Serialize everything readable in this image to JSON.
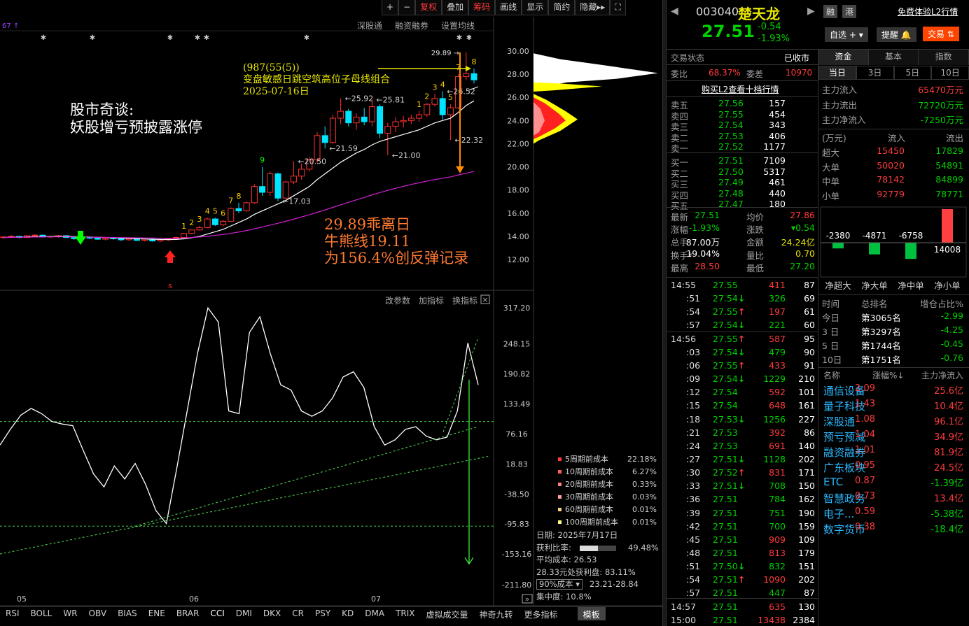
{
  "toolbar": {
    "items": [
      "+",
      "−",
      "复权",
      "叠加",
      "筹码",
      "画线",
      "显示",
      "简约",
      "隐藏▸▸",
      "⛶"
    ]
  },
  "subtoolbar": {
    "items": [
      "深股通",
      "融资融券",
      "设置均线"
    ]
  },
  "indicator_toolbar": {
    "items": [
      "改参数",
      "加指标",
      "换指标"
    ]
  },
  "annotations": {
    "title_line1": "股市奇谈:",
    "title_line2": "妖股增亏预披露涨停",
    "pattern_code": "(987(55(5))",
    "pattern_desc": "变盘敏感日跳空筑高位子母线组合",
    "pattern_date": "2025-07-16日",
    "div_line1": "29.89乖离日",
    "div_line2": "牛熊线19.11",
    "div_line3": "为156.4%创反弹记录",
    "peak_label": "29.89",
    "labels": [
      "25.92",
      "25.81",
      "26.52",
      "21.59",
      "21.00",
      "22.32",
      "20.50",
      "17.03"
    ]
  },
  "price_axis": [
    "30.00",
    "28.00",
    "26.00",
    "24.00",
    "22.00",
    "20.00",
    "18.00",
    "16.00",
    "14.00",
    "12.00"
  ],
  "cci_axis": [
    "317.20",
    "248.15",
    "190.82",
    "133.49",
    "76.16",
    "18.83",
    "-38.50",
    "-95.83",
    "-153.16",
    "-211.80"
  ],
  "x_months": [
    "05",
    "06",
    "07"
  ],
  "cost_distribution": {
    "legend": [
      {
        "label": "5周期前成本",
        "value": "22.18%",
        "color": "#ff3b3b"
      },
      {
        "label": "10周期前成本",
        "value": "6.27%",
        "color": "#ff6060"
      },
      {
        "label": "20周期前成本",
        "value": "0.33%",
        "color": "#ff8080"
      },
      {
        "label": "30周期前成本",
        "value": "0.03%",
        "color": "#ffa0a0"
      },
      {
        "label": "60周期前成本",
        "value": "0.01%",
        "color": "#ffd080"
      },
      {
        "label": "100周期前成本",
        "value": "0.01%",
        "color": "#ffff80"
      }
    ],
    "date_label": "日期: 2025年7月17日",
    "profit_ratio_label": "获利比率:",
    "profit_ratio": "49.48%",
    "profit_ratio_fill": 0.4948,
    "avg_cost": "平均成本: 26.53",
    "profit_at_price": "28.33元处获利盘: 83.11%",
    "cost_select": "90%成本",
    "cost_range": "23.21-28.84",
    "concentration": "集中度: 10.8%"
  },
  "bottom_tabs": [
    "RSI",
    "BOLL",
    "WR",
    "OBV",
    "BIAS",
    "ENE",
    "BRAR",
    "CCI",
    "DMI",
    "DKX",
    "CR",
    "PSY",
    "KD",
    "DMA",
    "TRIX",
    "虚拟成交量",
    "神奇九转",
    "更多指标",
    "模板"
  ],
  "stock": {
    "code": "003040",
    "name": "楚天龙",
    "price": "27.51",
    "change": "-0.54",
    "change_pct": "-1.93%",
    "tag_rong": "融",
    "tag_gang": "港",
    "l2_link": "免费体验L2行情",
    "btn_watch": "自选 +",
    "btn_alert": "提醒",
    "btn_trade": "交易"
  },
  "status": {
    "label": "交易状态",
    "value": "已收市",
    "weibi_label": "委比",
    "weibi": "68.37%",
    "weicha_label": "委差",
    "weicha": "10970",
    "l2_buy": "购买L2查看十档行情"
  },
  "orderbook": {
    "asks": [
      {
        "label": "卖五",
        "price": "27.56",
        "vol": "157"
      },
      {
        "label": "卖四",
        "price": "27.55",
        "vol": "454"
      },
      {
        "label": "卖三",
        "price": "27.54",
        "vol": "343"
      },
      {
        "label": "卖二",
        "price": "27.53",
        "vol": "406"
      },
      {
        "label": "卖一",
        "price": "27.52",
        "vol": "1177"
      }
    ],
    "bids": [
      {
        "label": "买一",
        "price": "27.51",
        "vol": "7109"
      },
      {
        "label": "买二",
        "price": "27.50",
        "vol": "5317"
      },
      {
        "label": "买三",
        "price": "27.49",
        "vol": "461"
      },
      {
        "label": "买四",
        "price": "27.48",
        "vol": "440"
      },
      {
        "label": "买五",
        "price": "27.47",
        "vol": "180"
      }
    ]
  },
  "stats": [
    {
      "l1": "最新",
      "v1": "27.51",
      "l2": "均价",
      "v2": "27.86",
      "c1": "green",
      "c2": "red"
    },
    {
      "l1": "涨幅",
      "v1": "-1.93%",
      "l2": "涨跌",
      "v2": "▾0.54",
      "c1": "green",
      "c2": "green"
    },
    {
      "l1": "总手",
      "v1": "87.00万",
      "l2": "金额",
      "v2": "24.24亿",
      "c1": "white",
      "c2": "yellow"
    },
    {
      "l1": "换手*",
      "v1": "19.04%",
      "l2": "量比",
      "v2": "0.70",
      "c1": "white",
      "c2": "yellow"
    },
    {
      "l1": "最高",
      "v1": "28.50",
      "l2": "最低",
      "v2": "27.20",
      "c1": "red",
      "c2": "green"
    }
  ],
  "ticks": [
    {
      "t": "14:55",
      "p": "27.55",
      "a": "",
      "v": "411",
      "n": "87",
      "pc": "green",
      "vc": "red"
    },
    {
      "t": ":51",
      "p": "27.54",
      "a": "↓",
      "v": "326",
      "n": "69",
      "pc": "green",
      "vc": "green"
    },
    {
      "t": ":54",
      "p": "27.55",
      "a": "↑",
      "v": "197",
      "n": "61",
      "pc": "green",
      "vc": "red"
    },
    {
      "t": ":57",
      "p": "27.54",
      "a": "↓",
      "v": "221",
      "n": "60",
      "pc": "green",
      "vc": "green"
    },
    {
      "t": "14:56",
      "p": "27.55",
      "a": "↑",
      "v": "587",
      "n": "95",
      "pc": "green",
      "vc": "red"
    },
    {
      "t": ":03",
      "p": "27.54",
      "a": "↓",
      "v": "479",
      "n": "90",
      "pc": "green",
      "vc": "green"
    },
    {
      "t": ":06",
      "p": "27.55",
      "a": "↑",
      "v": "433",
      "n": "91",
      "pc": "green",
      "vc": "red"
    },
    {
      "t": ":09",
      "p": "27.54",
      "a": "↓",
      "v": "1229",
      "n": "210",
      "pc": "green",
      "vc": "green"
    },
    {
      "t": ":12",
      "p": "27.54",
      "a": "",
      "v": "592",
      "n": "101",
      "pc": "green",
      "vc": "red"
    },
    {
      "t": ":15",
      "p": "27.54",
      "a": "",
      "v": "648",
      "n": "161",
      "pc": "green",
      "vc": "red"
    },
    {
      "t": ":18",
      "p": "27.53",
      "a": "↓",
      "v": "1256",
      "n": "227",
      "pc": "green",
      "vc": "green"
    },
    {
      "t": ":21",
      "p": "27.53",
      "a": "",
      "v": "392",
      "n": "86",
      "pc": "green",
      "vc": "red"
    },
    {
      "t": ":24",
      "p": "27.53",
      "a": "",
      "v": "691",
      "n": "140",
      "pc": "green",
      "vc": "red"
    },
    {
      "t": ":27",
      "p": "27.51",
      "a": "↓",
      "v": "1128",
      "n": "202",
      "pc": "green",
      "vc": "green"
    },
    {
      "t": ":30",
      "p": "27.52",
      "a": "↑",
      "v": "831",
      "n": "171",
      "pc": "green",
      "vc": "red"
    },
    {
      "t": ":33",
      "p": "27.51",
      "a": "↓",
      "v": "708",
      "n": "150",
      "pc": "green",
      "vc": "green"
    },
    {
      "t": ":36",
      "p": "27.51",
      "a": "",
      "v": "784",
      "n": "162",
      "pc": "green",
      "vc": "green"
    },
    {
      "t": ":39",
      "p": "27.51",
      "a": "",
      "v": "751",
      "n": "190",
      "pc": "green",
      "vc": "green"
    },
    {
      "t": ":42",
      "p": "27.51",
      "a": "",
      "v": "700",
      "n": "159",
      "pc": "green",
      "vc": "green"
    },
    {
      "t": ":45",
      "p": "27.51",
      "a": "",
      "v": "909",
      "n": "109",
      "pc": "green",
      "vc": "red"
    },
    {
      "t": ":48",
      "p": "27.51",
      "a": "",
      "v": "813",
      "n": "179",
      "pc": "green",
      "vc": "red"
    },
    {
      "t": ":51",
      "p": "27.50",
      "a": "↓",
      "v": "832",
      "n": "151",
      "pc": "green",
      "vc": "green"
    },
    {
      "t": ":54",
      "p": "27.51",
      "a": "↑",
      "v": "1090",
      "n": "202",
      "pc": "green",
      "vc": "red"
    },
    {
      "t": ":57",
      "p": "27.51",
      "a": "",
      "v": "447",
      "n": "87",
      "pc": "green",
      "vc": "green"
    },
    {
      "t": "14:57",
      "p": "27.51",
      "a": "",
      "v": "635",
      "n": "130",
      "pc": "green",
      "vc": "red"
    },
    {
      "t": "15:00",
      "p": "27.51",
      "a": "",
      "v": "13438",
      "n": "2384",
      "pc": "green",
      "vc": "red"
    }
  ],
  "fund_tabs": [
    "资金",
    "基本",
    "指数"
  ],
  "period_tabs": [
    "当日",
    "3日",
    "5日",
    "10日"
  ],
  "main_flow": [
    {
      "label": "主力流入",
      "value": "65470万元",
      "color": "red"
    },
    {
      "label": "主力流出",
      "value": "72720万元",
      "color": "green"
    },
    {
      "label": "主力净流入",
      "value": "-7250万元",
      "color": "green"
    }
  ],
  "flow_header": {
    "unit": "(万元)",
    "in": "流入",
    "out": "流出"
  },
  "flow_table": [
    {
      "label": "超大",
      "in": "15450",
      "out": "17829"
    },
    {
      "label": "大单",
      "in": "50020",
      "out": "54891"
    },
    {
      "label": "中单",
      "in": "78142",
      "out": "84899"
    },
    {
      "label": "小单",
      "in": "92779",
      "out": "78771"
    }
  ],
  "net_flow": {
    "values": [
      -2380,
      -4871,
      -6758,
      14008
    ],
    "labels": [
      "-2380",
      "-4871",
      "-6758",
      "14008"
    ],
    "categories": [
      "净超大",
      "净大单",
      "净中单",
      "净小单"
    ]
  },
  "rank": {
    "header": [
      "时间",
      "总排名",
      "增仓占比%"
    ],
    "rows": [
      {
        "time": "今日",
        "rank": "第3065名",
        "ratio": "-2.99"
      },
      {
        "time": "3 日",
        "rank": "第3297名",
        "ratio": "-4.25"
      },
      {
        "time": "5 日",
        "rank": "第1744名",
        "ratio": "-0.45"
      },
      {
        "time": "10日",
        "rank": "第1751名",
        "ratio": "-0.76"
      }
    ]
  },
  "sectors": {
    "header": [
      "名称",
      "涨幅%↓",
      "主力净流入"
    ],
    "rows": [
      {
        "name": "通信设备",
        "pct": "2.09",
        "flow": "25.6亿",
        "fc": "red"
      },
      {
        "name": "量子科技",
        "pct": "1.43",
        "flow": "10.4亿",
        "fc": "red"
      },
      {
        "name": "深股通",
        "pct": "1.08",
        "flow": "96.1亿",
        "fc": "red"
      },
      {
        "name": "预亏预减",
        "pct": "1.04",
        "flow": "34.9亿",
        "fc": "red"
      },
      {
        "name": "融资融券",
        "pct": "1.01",
        "flow": "81.9亿",
        "fc": "red"
      },
      {
        "name": "广东板块",
        "pct": "0.95",
        "flow": "24.5亿",
        "fc": "red"
      },
      {
        "name": "ETC",
        "pct": "0.87",
        "flow": "-1.39亿",
        "fc": "green"
      },
      {
        "name": "智慧政务",
        "pct": "0.73",
        "flow": "13.4亿",
        "fc": "red"
      },
      {
        "name": "电子...",
        "pct": "0.59",
        "flow": "-5.38亿",
        "fc": "green"
      },
      {
        "name": "数字货币",
        "pct": "0.38",
        "flow": "-18.4亿",
        "fc": "green"
      }
    ]
  },
  "chart_data": [
    {
      "type": "candlestick",
      "title": "",
      "ylim": [
        11,
        31
      ],
      "candles": [
        [
          13.9,
          14.0,
          13.8,
          13.95
        ],
        [
          13.95,
          14.1,
          13.85,
          14.0
        ],
        [
          14.0,
          14.05,
          13.8,
          13.9
        ],
        [
          13.9,
          14.1,
          13.85,
          14.05
        ],
        [
          14.05,
          14.2,
          13.95,
          14.1
        ],
        [
          14.1,
          14.15,
          13.9,
          13.95
        ],
        [
          13.95,
          14.05,
          13.85,
          14.0
        ],
        [
          14.0,
          14.1,
          13.9,
          14.05
        ],
        [
          14.05,
          14.1,
          13.85,
          13.9
        ],
        [
          13.9,
          14.0,
          13.7,
          13.8
        ],
        [
          13.8,
          13.95,
          13.7,
          13.9
        ],
        [
          13.9,
          14.0,
          13.75,
          13.85
        ],
        [
          13.85,
          13.95,
          13.7,
          13.75
        ],
        [
          13.75,
          13.9,
          13.65,
          13.85
        ],
        [
          13.85,
          13.95,
          13.7,
          13.8
        ],
        [
          13.8,
          13.9,
          13.6,
          13.7
        ],
        [
          13.7,
          13.85,
          13.6,
          13.8
        ],
        [
          13.8,
          13.9,
          13.6,
          13.65
        ],
        [
          13.65,
          13.8,
          13.55,
          13.75
        ],
        [
          13.75,
          13.85,
          13.55,
          13.6
        ],
        [
          13.6,
          13.75,
          13.5,
          13.7
        ],
        [
          13.7,
          13.85,
          13.6,
          13.8
        ],
        [
          13.8,
          14.0,
          13.7,
          13.9
        ],
        [
          13.9,
          14.3,
          13.85,
          14.25
        ],
        [
          14.25,
          14.6,
          14.2,
          14.55
        ],
        [
          14.55,
          14.9,
          14.5,
          14.75
        ],
        [
          14.75,
          15.6,
          14.7,
          15.5
        ],
        [
          15.5,
          15.6,
          14.9,
          15.0
        ],
        [
          15.0,
          15.4,
          14.85,
          15.3
        ],
        [
          15.3,
          16.5,
          15.25,
          16.4
        ],
        [
          16.4,
          16.9,
          16.0,
          16.2
        ],
        [
          16.2,
          17.0,
          16.1,
          16.9
        ],
        [
          16.9,
          18.5,
          16.8,
          18.3
        ],
        [
          18.3,
          20.0,
          17.5,
          17.8
        ],
        [
          17.8,
          19.6,
          17.5,
          19.4
        ],
        [
          19.4,
          19.5,
          17.03,
          17.3
        ],
        [
          17.3,
          18.8,
          17.2,
          18.7
        ],
        [
          18.7,
          20.5,
          18.5,
          19.2
        ],
        [
          19.2,
          20.3,
          18.9,
          19.8
        ],
        [
          19.8,
          20.8,
          19.6,
          20.6
        ],
        [
          20.6,
          23.0,
          20.3,
          22.7
        ],
        [
          22.7,
          23.5,
          21.59,
          22.1
        ],
        [
          22.1,
          24.5,
          22.0,
          24.2
        ],
        [
          24.2,
          25.92,
          23.7,
          24.8
        ],
        [
          24.8,
          25.0,
          23.5,
          23.8
        ],
        [
          23.8,
          24.6,
          23.2,
          24.3
        ],
        [
          24.3,
          25.1,
          23.6,
          23.9
        ],
        [
          23.9,
          25.81,
          23.5,
          25.2
        ],
        [
          25.2,
          25.4,
          22.5,
          22.9
        ],
        [
          22.9,
          23.8,
          21.0,
          23.5
        ],
        [
          23.5,
          24.3,
          23.0,
          23.9
        ],
        [
          23.9,
          24.4,
          23.4,
          24.0
        ],
        [
          24.0,
          24.5,
          23.7,
          24.2
        ],
        [
          24.2,
          24.8,
          23.9,
          24.5
        ],
        [
          24.5,
          25.5,
          24.3,
          25.4
        ],
        [
          25.4,
          26.3,
          25.2,
          25.9
        ],
        [
          25.9,
          26.52,
          24.1,
          24.5
        ],
        [
          24.5,
          25.4,
          22.32,
          25.1
        ],
        [
          25.1,
          28.0,
          25.0,
          27.8
        ],
        [
          27.8,
          29.89,
          27.5,
          28.05
        ],
        [
          28.05,
          28.5,
          27.2,
          27.51
        ]
      ],
      "ma_short": [
        13.9,
        13.92,
        13.93,
        13.95,
        13.97,
        13.98,
        13.99,
        14.0,
        14.0,
        13.98,
        13.96,
        13.94,
        13.92,
        13.9,
        13.88,
        13.85,
        13.82,
        13.8,
        13.77,
        13.75,
        13.73,
        13.72,
        13.73,
        13.78,
        13.88,
        14.0,
        14.2,
        14.4,
        14.6,
        14.9,
        15.2,
        15.5,
        15.9,
        16.2,
        16.5,
        16.8,
        17.1,
        17.5,
        17.9,
        18.3,
        18.9,
        19.4,
        19.9,
        20.4,
        20.8,
        21.2,
        21.5,
        21.9,
        22.2,
        22.4,
        22.6,
        22.8,
        23.0,
        23.2,
        23.5,
        23.8,
        24.0,
        24.2,
        24.7,
        25.3,
        25.7
      ],
      "ma_long": [
        13.9,
        13.91,
        13.92,
        13.93,
        13.94,
        13.95,
        13.96,
        13.96,
        13.96,
        13.95,
        13.94,
        13.93,
        13.92,
        13.91,
        13.9,
        13.89,
        13.88,
        13.87,
        13.86,
        13.85,
        13.84,
        13.84,
        13.84,
        13.86,
        13.9,
        13.95,
        14.0,
        14.08,
        14.16,
        14.26,
        14.37,
        14.5,
        14.65,
        14.8,
        14.97,
        15.13,
        15.3,
        15.48,
        15.67,
        15.86,
        16.07,
        16.28,
        16.5,
        16.72,
        16.94,
        17.15,
        17.36,
        17.58,
        17.78,
        17.97,
        18.15,
        18.32,
        18.48,
        18.63,
        18.77,
        18.9,
        19.02,
        19.13,
        19.3,
        19.45,
        19.6
      ]
    },
    {
      "type": "line",
      "title": "",
      "series": [
        {
          "values": [
            55,
            85,
            112,
            125,
            115,
            100,
            95,
            92,
            45,
            0,
            -25,
            15,
            -10,
            20,
            -20,
            -70,
            -95,
            10,
            120,
            230,
            317,
            290,
            120,
            115,
            270,
            300,
            230,
            170,
            160,
            120,
            110,
            120,
            145,
            185,
            195,
            165,
            90,
            55,
            65,
            85,
            90,
            72,
            65,
            70,
            120,
            250,
            170
          ]
        }
      ],
      "ylim": [
        -211.8,
        317.2
      ]
    }
  ]
}
